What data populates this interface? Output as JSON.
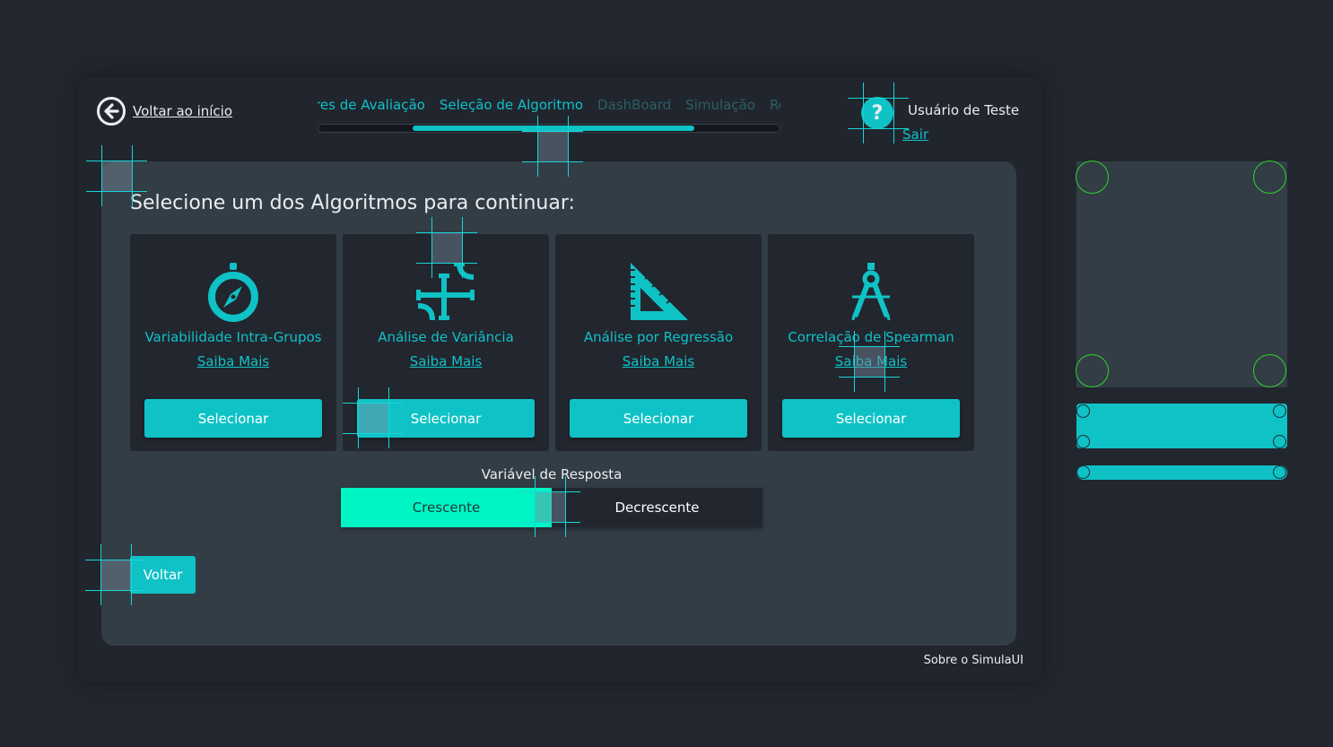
{
  "header": {
    "back_label": "Voltar ao início",
    "steps": [
      {
        "label": "tores de Avaliação",
        "state": "done"
      },
      {
        "label": "Seleção de Algoritmo",
        "state": "active"
      },
      {
        "label": "DashBoard",
        "state": "pending"
      },
      {
        "label": "Simulação",
        "state": "pending"
      },
      {
        "label": "Re",
        "state": "pending"
      }
    ],
    "help_symbol": "?",
    "user_name": "Usuário de Teste",
    "logout_label": "Sair"
  },
  "main": {
    "title": "Selecione um dos Algoritmos para continuar:",
    "cards": [
      {
        "icon": "compass-icon",
        "title": "Variabilidade Intra-Grupos",
        "link": "Saiba Mais",
        "button": "Selecionar"
      },
      {
        "icon": "pipes-icon",
        "title": "Análise de Variância",
        "link": "Saiba Mais",
        "button": "Selecionar"
      },
      {
        "icon": "set-square-icon",
        "title": "Análise por Regressão",
        "link": "Saiba Mais",
        "button": "Selecionar"
      },
      {
        "icon": "drafting-compass-icon",
        "title": "Correlação de Spearman",
        "link": "Saiba Mais",
        "button": "Selecionar"
      }
    ],
    "response_label": "Variável de Resposta",
    "toggle": {
      "options": [
        "Crescente",
        "Decrescente"
      ],
      "selected": "Crescente"
    },
    "back_button": "Voltar"
  },
  "footer": {
    "about": "Sobre o SimulaUI"
  },
  "colors": {
    "accent": "#0fc2c6",
    "toggle_on": "#00f5c4",
    "panel": "#333d46",
    "background": "#22262f"
  }
}
